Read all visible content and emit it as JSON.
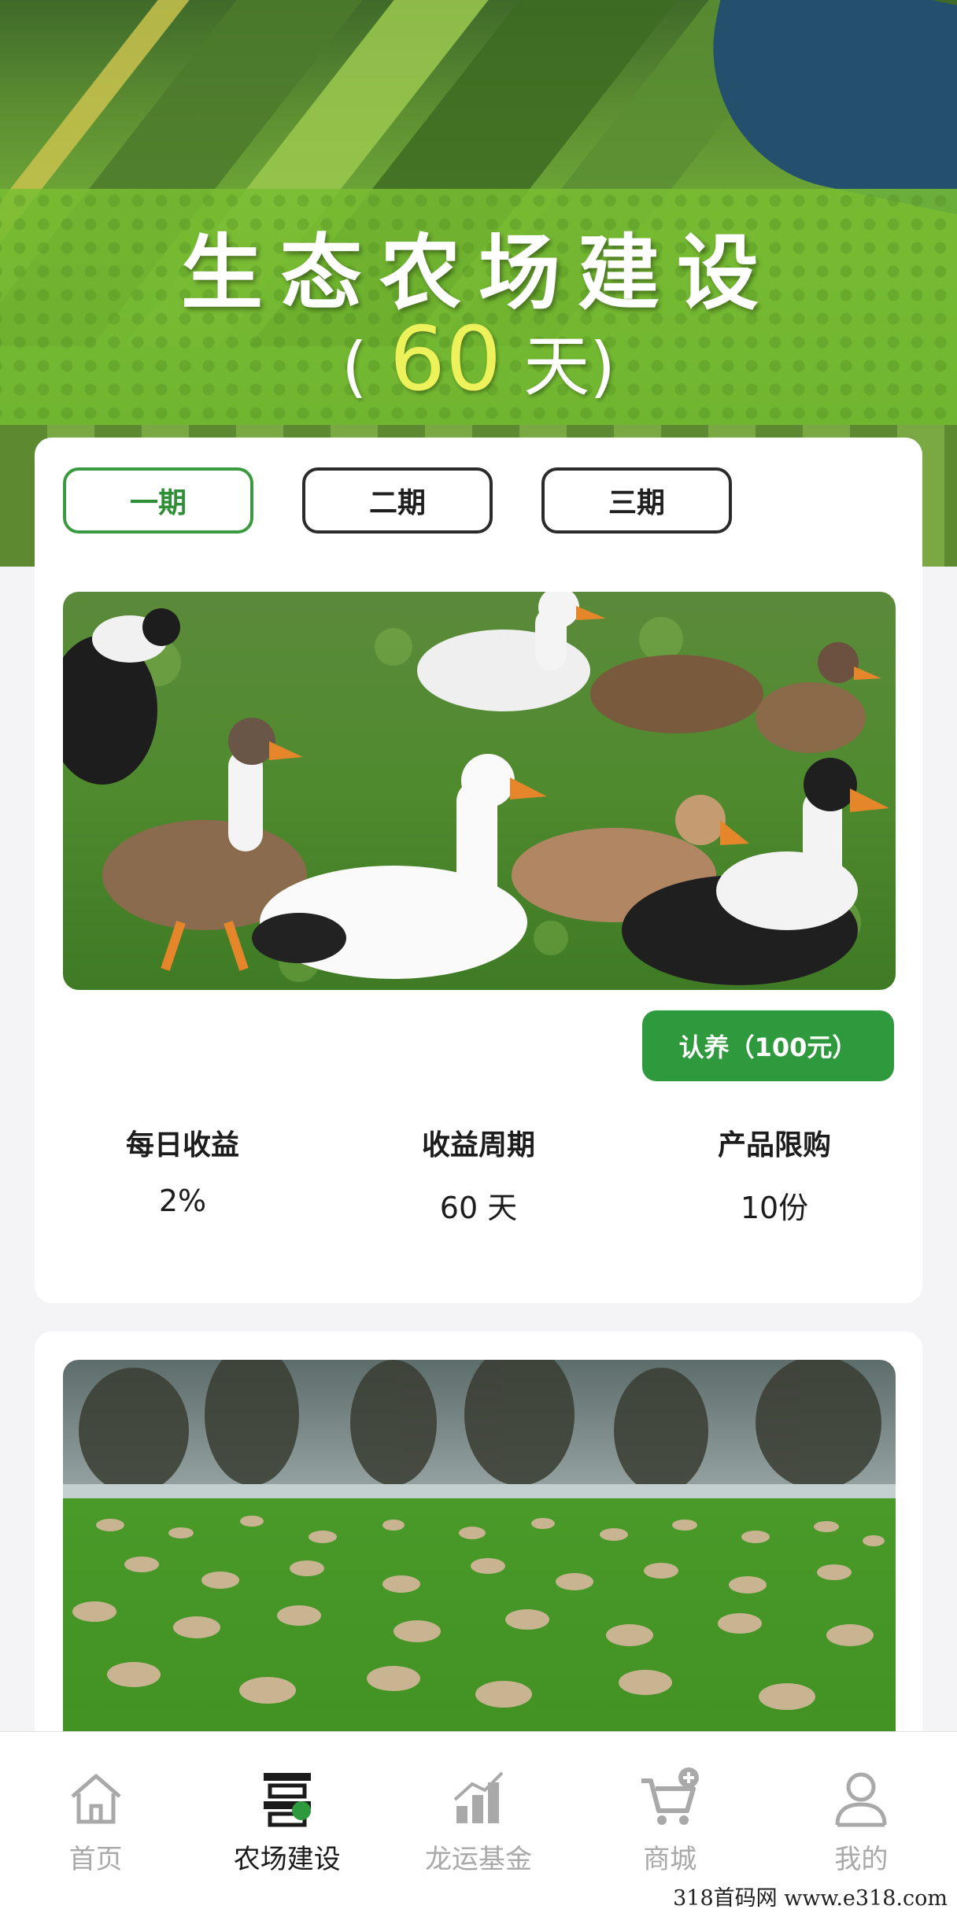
{
  "hero": {
    "title": "生态农场建设",
    "subtitle_open": "(",
    "subtitle_number": "60",
    "subtitle_unit": "天)"
  },
  "tabs": [
    {
      "label": "一期",
      "active": true
    },
    {
      "label": "二期",
      "active": false
    },
    {
      "label": "三期",
      "active": false
    }
  ],
  "product1": {
    "image": "ducks-on-grass",
    "adopt_label": "认养（100元）",
    "stats": [
      {
        "label": "每日收益",
        "value": "2%"
      },
      {
        "label": "收益周期",
        "value": "60 天"
      },
      {
        "label": "产品限购",
        "value": "10份"
      }
    ]
  },
  "product2": {
    "image": "sheep-on-pasture"
  },
  "nav": [
    {
      "label": "首页",
      "icon": "home-icon",
      "active": false
    },
    {
      "label": "农场建设",
      "icon": "farm-build-icon",
      "active": true
    },
    {
      "label": "龙运基金",
      "icon": "chart-icon",
      "active": false
    },
    {
      "label": "商城",
      "icon": "cart-icon",
      "active": false
    },
    {
      "label": "我的",
      "icon": "user-icon",
      "active": false
    }
  ],
  "watermark": "318首码网 www.e318.com",
  "colors": {
    "accent": "#2f9a3d",
    "active_tab": "#3a9a3f",
    "hero_number": "#eef25a"
  }
}
